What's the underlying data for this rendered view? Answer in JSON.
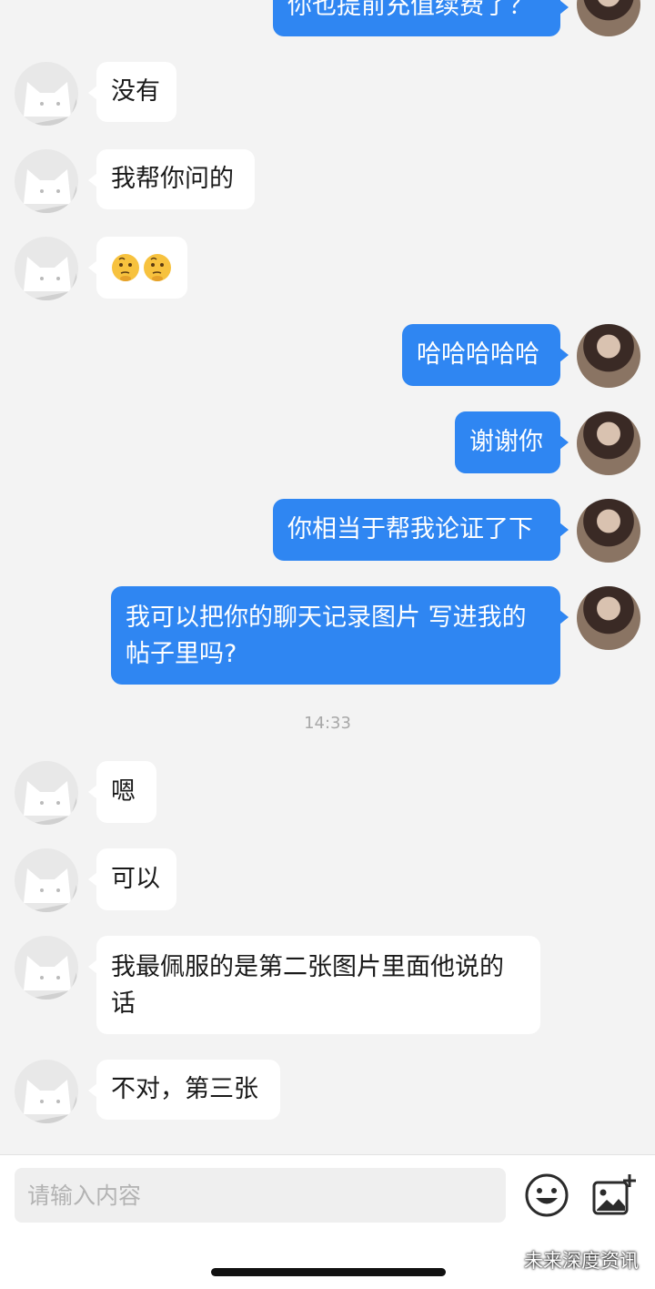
{
  "messages": {
    "m0": "你也提前充值续费了？",
    "m1": "没有",
    "m2": "我帮你问的",
    "m3": "🤔🤔",
    "m4": "哈哈哈哈哈",
    "m5": "谢谢你",
    "m6": "你相当于帮我论证了下",
    "m7a": "我可以把你的聊天记录图片 写进我的",
    "m7b": "帖子里吗?",
    "m8": "嗯",
    "m9": "可以",
    "m10a": "我最佩服的是第二张图片里面他说的",
    "m10b": "话",
    "m11": "不对，第三张"
  },
  "timestamp": "14:33",
  "composer": {
    "placeholder": "请输入内容",
    "emoji_icon": "smiley-icon",
    "image_icon": "add-image-icon"
  },
  "watermark": "未来深度资讯",
  "colors": {
    "accent": "#2f86f2",
    "background": "#f3f3f3"
  }
}
